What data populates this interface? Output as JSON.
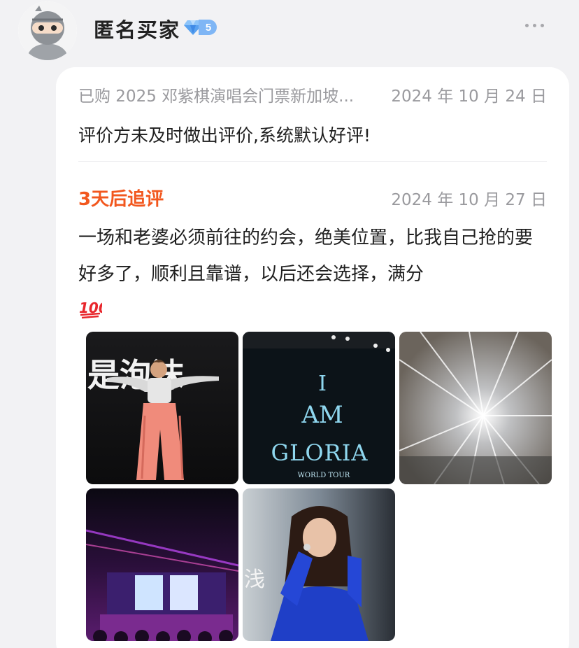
{
  "header": {
    "username": "匿名买家",
    "badge_level": "5",
    "avatar_icon": "ninja-avatar-icon",
    "more_icon": "more-dots-icon"
  },
  "review": {
    "purchased_text": "已购 2025 邓紫棋演唱会门票新加坡...",
    "date": "2024 年 10 月 24 日",
    "default_text": "评价方未及时做出评价,系统默认好评!"
  },
  "followup": {
    "label": "3天后追评",
    "date": "2024 年 10 月 27 日",
    "text": "一场和老婆必须前往的约会，绝美位置，比我自己抢的要好多了，顺利且靠谱，以后还会选择，满分",
    "emoji": "💯"
  },
  "photos": [
    {
      "alt": "concert-photo-singer-pink-pants",
      "overlay_text": "是泡沫"
    },
    {
      "alt": "concert-photo-stage-screen",
      "overlay_line1": "I",
      "overlay_line2": "AM",
      "overlay_line3": "GLORIA",
      "overlay_line4": "WORLD TOUR"
    },
    {
      "alt": "concert-photo-stage-lights"
    },
    {
      "alt": "concert-photo-stage-wide"
    },
    {
      "alt": "concert-photo-singer-blue-outfit",
      "overlay_text": "浅"
    }
  ],
  "colors": {
    "accent": "#f2571e",
    "muted": "#9a9a9e",
    "badge": "#7fb6f5",
    "background": "#f2f2f4"
  }
}
